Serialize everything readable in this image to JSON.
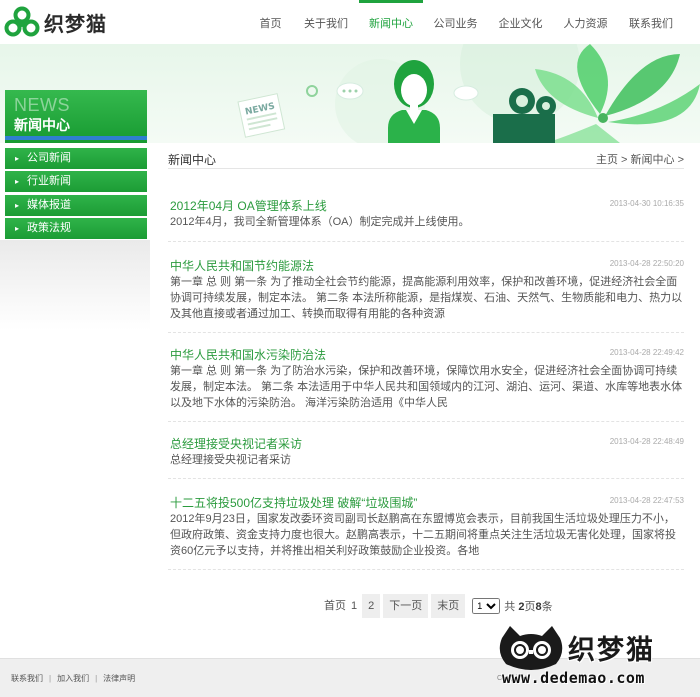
{
  "brand": {
    "name": "织梦猫",
    "color": "#1fa33e"
  },
  "nav": [
    {
      "label": "首页",
      "active": false
    },
    {
      "label": "关于我们",
      "active": false
    },
    {
      "label": "新闻中心",
      "active": true
    },
    {
      "label": "公司业务",
      "active": false
    },
    {
      "label": "企业文化",
      "active": false
    },
    {
      "label": "人力资源",
      "active": false
    },
    {
      "label": "联系我们",
      "active": false
    }
  ],
  "banner": {
    "news_tag": "NEWS"
  },
  "sidebar": {
    "title_en": "NEWS",
    "title_cn": "新闻中心",
    "items": [
      {
        "label": "公司新闻"
      },
      {
        "label": "行业新闻"
      },
      {
        "label": "媒体报道"
      },
      {
        "label": "政策法规"
      }
    ]
  },
  "content": {
    "title": "新闻中心",
    "breadcrumb": {
      "home": "主页",
      "sep1": " > ",
      "current": "新闻中心",
      "sep2": " >"
    },
    "articles": [
      {
        "title": "2012年04月 OA管理体系上线",
        "date": "2013-04-30 10:16:35",
        "body": "2012年4月，我司全新管理体系（OA）制定完成并上线使用。"
      },
      {
        "title": "中华人民共和国节约能源法",
        "date": "2013-04-28 22:50:20",
        "body": "第一章 总 则 第一条 为了推动全社会节约能源，提高能源利用效率，保护和改善环境，促进经济社会全面协调可持续发展，制定本法。 第二条 本法所称能源，是指煤炭、石油、天然气、生物质能和电力、热力以及其他直接或者通过加工、转换而取得有用能的各种资源"
      },
      {
        "title": "中华人民共和国水污染防治法",
        "date": "2013-04-28 22:49:42",
        "body": "第一章 总 则 第一条 为了防治水污染，保护和改善环境，保障饮用水安全，促进经济社会全面协调可持续发展，制定本法。 第二条 本法适用于中华人民共和国领域内的江河、湖泊、运河、渠道、水库等地表水体以及地下水体的污染防治。 海洋污染防治适用《中华人民"
      },
      {
        "title": "总经理接受央视记者采访",
        "date": "2013-04-28 22:48:49",
        "body": "总经理接受央视记者采访"
      },
      {
        "title": "十二五将投500亿支持垃圾处理 破解“垃圾围城”",
        "date": "2013-04-28 22:47:53",
        "body": "2012年9月23日，国家发改委环资司副司长赵鹏高在东盟博览会表示，目前我国生活垃圾处理压力不小，但政府政策、资金支持力度也很大。赵鹏高表示，十二五期间将重点关注生活垃圾无害化处理，国家将投资60亿元予以支持，并将推出相关利好政策鼓励企业投资。各地"
      }
    ]
  },
  "pagination": {
    "first": "首页",
    "page1": "1",
    "page2": "2",
    "next": "下一页",
    "last": "末页",
    "select_value": "1",
    "total_prefix": "共 ",
    "total_pages": "2",
    "pages_word": "页",
    "total_items": "8",
    "items_word": "条"
  },
  "footer": {
    "links": [
      {
        "label": "联系我们"
      },
      {
        "label": "加入我们"
      },
      {
        "label": "法律声明"
      }
    ],
    "separator": "|",
    "copyright": "Copyright"
  },
  "watermark": {
    "name": "织梦猫",
    "url": "www.dedemao.com"
  }
}
